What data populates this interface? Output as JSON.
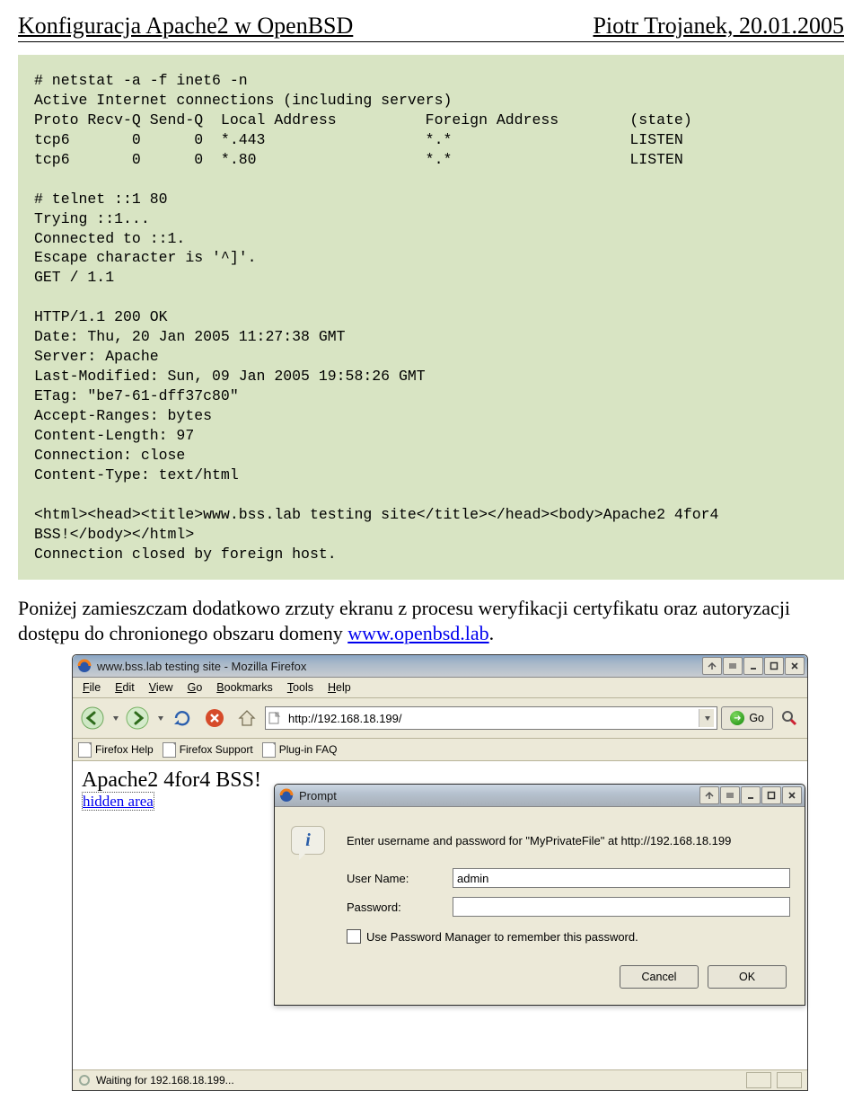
{
  "header": {
    "left": "Konfiguracja Apache2 w OpenBSD",
    "right": "Piotr Trojanek, 20.01.2005"
  },
  "code_block": "# netstat -a -f inet6 -n\nActive Internet connections (including servers)\nProto Recv-Q Send-Q  Local Address          Foreign Address        (state)\ntcp6       0      0  *.443                  *.*                    LISTEN\ntcp6       0      0  *.80                   *.*                    LISTEN\n\n# telnet ::1 80\nTrying ::1...\nConnected to ::1.\nEscape character is '^]'.\nGET / 1.1\n\nHTTP/1.1 200 OK\nDate: Thu, 20 Jan 2005 11:27:38 GMT\nServer: Apache\nLast-Modified: Sun, 09 Jan 2005 19:58:26 GMT\nETag: \"be7-61-dff37c80\"\nAccept-Ranges: bytes\nContent-Length: 97\nConnection: close\nContent-Type: text/html\n\n<html><head><title>www.bss.lab testing site</title></head><body>Apache2 4for4\nBSS!</body></html>\nConnection closed by foreign host.",
  "body_text": {
    "prefix": "Poniżej zamieszczam dodatkowo zrzuty ekranu z procesu weryfikacji certyfikatu oraz autoryzacji dostępu do chronionego obszaru domeny ",
    "link": "www.openbsd.lab",
    "suffix": "."
  },
  "browser": {
    "title": "www.bss.lab testing site - Mozilla Firefox",
    "menus": [
      "File",
      "Edit",
      "View",
      "Go",
      "Bookmarks",
      "Tools",
      "Help"
    ],
    "url": "http://192.168.18.199/",
    "go_label": "Go",
    "bookmarks": [
      "Firefox Help",
      "Firefox Support",
      "Plug-in FAQ"
    ],
    "page": {
      "line1": "Apache2 4for4 BSS!",
      "link": "hidden area"
    },
    "status": "Waiting for 192.168.18.199..."
  },
  "dialog": {
    "title": "Prompt",
    "message": "Enter username and password for \"MyPrivateFile\" at http://192.168.18.199",
    "labels": {
      "user": "User Name:",
      "pass": "Password:"
    },
    "user_value": "admin",
    "pass_value": "",
    "remember": "Use Password Manager to remember this password.",
    "cancel": "Cancel",
    "ok": "OK"
  }
}
